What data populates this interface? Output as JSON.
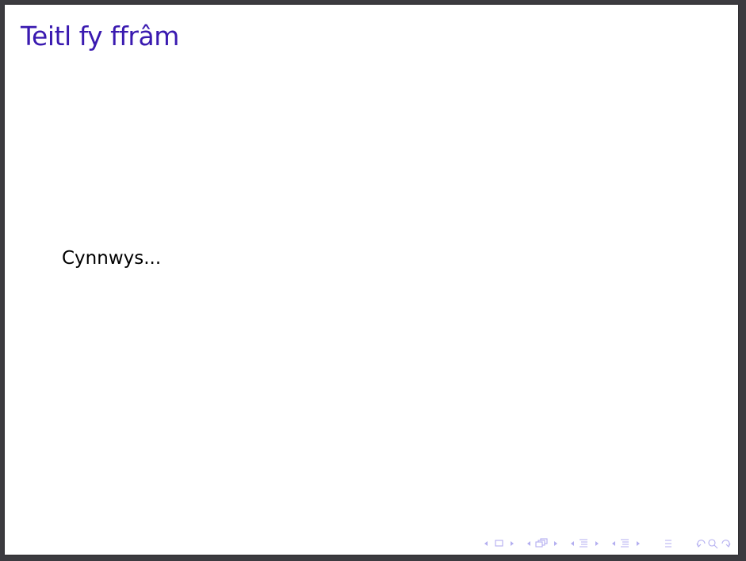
{
  "slide": {
    "title": "Teitl fy ffrâm",
    "body": "Cynnwys..."
  },
  "colors": {
    "title": "#3a1ab0",
    "navigation": "#b3aef0",
    "slide_background": "#ffffff",
    "window_border": "#3c3b40"
  },
  "navigation": {
    "icons": [
      "prev-arrow-icon",
      "frame-icon",
      "next-arrow-icon",
      "prev-arrow-icon",
      "subsection-icon",
      "next-arrow-icon",
      "prev-arrow-icon",
      "section-icon",
      "next-arrow-icon",
      "prev-arrow-icon",
      "presentation-icon",
      "next-arrow-icon",
      "appendix-icon",
      "back-icon",
      "search-icon",
      "forward-icon"
    ]
  }
}
